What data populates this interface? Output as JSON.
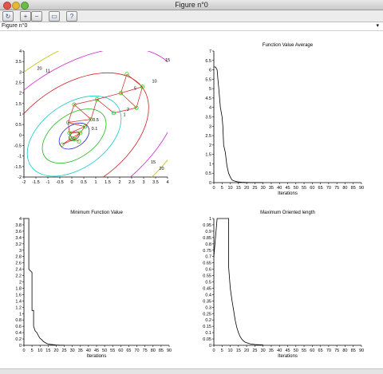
{
  "window": {
    "title": "Figure n°0"
  },
  "toolbar": {
    "buttons": [
      {
        "name": "rotate-icon",
        "glyph": "↻"
      },
      {
        "name": "zoom-in-icon",
        "glyph": "+"
      },
      {
        "name": "zoom-out-icon",
        "glyph": "−"
      },
      {
        "name": "datatip-icon",
        "glyph": "▭"
      },
      {
        "name": "help-icon",
        "glyph": "?"
      }
    ]
  },
  "figure_label": "Figure n°0",
  "menu_glyph": "▾",
  "chart_data": [
    {
      "type": "contour",
      "title": "",
      "xticks": [
        "-2",
        "-1.5",
        "-1",
        "-0.5",
        "0",
        "0.5",
        "1",
        "1.5",
        "2",
        "2.5",
        "3",
        "3.5",
        "4"
      ],
      "yticks": [
        "-2",
        "-1.5",
        "-1",
        "-0.5",
        "0",
        "0.5",
        "1",
        "1.5",
        "2",
        "2.5",
        "3",
        "3.5",
        "4"
      ],
      "xlim": [
        -2,
        4
      ],
      "ylim": [
        -2,
        4
      ],
      "contours": [
        {
          "level": "0.1",
          "color": "#444444",
          "rx": 0.25,
          "ry": 0.15
        },
        {
          "level": "0.5",
          "color": "#2a2ad0",
          "rx": 0.7,
          "ry": 0.45
        },
        {
          "level": "1",
          "color": "#1bb81b",
          "rx": 1.5,
          "ry": 0.9
        },
        {
          "level": "2",
          "color": "#14c9c9",
          "rx": 2.2,
          "ry": 1.35
        },
        {
          "level": "5",
          "color": "#d02020",
          "rx": 3.5,
          "ry": 2.1
        },
        {
          "level": "10",
          "color": "#d020d0",
          "rx": 5.0,
          "ry": 2.8
        },
        {
          "level": "15",
          "color": "#c0c000",
          "rx": 6.0,
          "ry": 3.4
        }
      ],
      "contour_labels": [
        "0.1",
        "0.5",
        "1",
        "2",
        "5",
        "10",
        "11",
        "15",
        "15",
        "20",
        "20"
      ],
      "simplex_points": [
        [
          2.3,
          2.9
        ],
        [
          2.95,
          2.3
        ],
        [
          2.05,
          2.0
        ],
        [
          2.7,
          1.3
        ],
        [
          1.05,
          1.7
        ],
        [
          1.75,
          1.05
        ],
        [
          0.1,
          1.45
        ],
        [
          0.8,
          0.75
        ],
        [
          -0.15,
          0.6
        ],
        [
          0.55,
          0.4
        ],
        [
          -0.1,
          0.1
        ],
        [
          0.35,
          0.1
        ],
        [
          0.0,
          -0.15
        ],
        [
          -0.4,
          -0.45
        ],
        [
          0.1,
          -0.2
        ],
        [
          0.3,
          -0.3
        ]
      ],
      "simplex_path": [
        [
          2.3,
          2.9
        ],
        [
          2.95,
          2.3
        ],
        [
          2.05,
          2.0
        ],
        [
          2.3,
          2.9
        ],
        [
          2.05,
          2.0
        ],
        [
          2.7,
          1.3
        ],
        [
          2.95,
          2.3
        ],
        [
          2.05,
          2.0
        ],
        [
          1.05,
          1.7
        ],
        [
          1.75,
          1.05
        ],
        [
          2.7,
          1.3
        ],
        [
          1.75,
          1.05
        ],
        [
          1.05,
          1.7
        ],
        [
          0.1,
          1.45
        ],
        [
          0.8,
          0.75
        ],
        [
          1.05,
          1.7
        ],
        [
          0.8,
          0.75
        ],
        [
          -0.15,
          0.6
        ],
        [
          0.1,
          1.45
        ],
        [
          0.8,
          0.75
        ],
        [
          0.55,
          0.4
        ],
        [
          -0.15,
          0.6
        ],
        [
          -0.1,
          0.1
        ],
        [
          0.55,
          0.4
        ],
        [
          0.35,
          0.1
        ],
        [
          -0.1,
          0.1
        ],
        [
          0.0,
          -0.15
        ],
        [
          0.35,
          0.1
        ],
        [
          0.1,
          -0.2
        ],
        [
          -0.4,
          -0.45
        ],
        [
          0.0,
          -0.15
        ],
        [
          0.3,
          -0.3
        ],
        [
          0.1,
          -0.2
        ]
      ]
    },
    {
      "type": "line",
      "title": "Function Value Average",
      "xlabel": "Iterations",
      "xticks": [
        "0",
        "5",
        "10",
        "15",
        "20",
        "25",
        "30",
        "35",
        "40",
        "45",
        "50",
        "55",
        "60",
        "65",
        "70",
        "75",
        "80",
        "85",
        "90"
      ],
      "yticks": [
        "0",
        "0.5",
        "1",
        "1.5",
        "2",
        "2.5",
        "3",
        "3.5",
        "4",
        "4.5",
        "5",
        "5.5",
        "6",
        "6.5",
        "7"
      ],
      "xlim": [
        0,
        90
      ],
      "ylim": [
        0,
        7
      ],
      "x": [
        0,
        1,
        2,
        2.5,
        3,
        4,
        5,
        5.5,
        6,
        7,
        8,
        9,
        10,
        11,
        12,
        13,
        14,
        15,
        16,
        17,
        18,
        19,
        20,
        22,
        25,
        30
      ],
      "y": [
        6.15,
        6.15,
        6.0,
        5.5,
        5.0,
        4.0,
        3.5,
        3.0,
        2.0,
        1.6,
        0.9,
        0.5,
        0.3,
        0.15,
        0.1,
        0.07,
        0.05,
        0.04,
        0.03,
        0.02,
        0.015,
        0.01,
        0.008,
        0.005,
        0.003,
        0.002
      ]
    },
    {
      "type": "line",
      "title": "Minimum Function Value",
      "xlabel": "Iterations",
      "xticks": [
        "0",
        "5",
        "10",
        "15",
        "20",
        "25",
        "30",
        "35",
        "40",
        "45",
        "50",
        "55",
        "60",
        "65",
        "70",
        "75",
        "80",
        "85",
        "90"
      ],
      "yticks": [
        "0",
        "0.2",
        "0.4",
        "0.6",
        "0.8",
        "1",
        "1.2",
        "1.4",
        "1.6",
        "1.8",
        "2",
        "2.2",
        "2.4",
        "2.6",
        "2.8",
        "3",
        "3.2",
        "3.4",
        "3.6",
        "3.8",
        "4"
      ],
      "xlim": [
        0,
        90
      ],
      "ylim": [
        0,
        4
      ],
      "x": [
        0,
        3,
        3,
        5,
        5,
        6,
        6,
        7,
        8,
        9,
        10,
        11,
        12,
        13,
        14,
        15,
        16,
        18,
        20,
        22,
        25
      ],
      "y": [
        4.0,
        4.0,
        2.4,
        2.3,
        1.1,
        1.1,
        0.6,
        0.45,
        0.4,
        0.3,
        0.22,
        0.18,
        0.12,
        0.09,
        0.06,
        0.04,
        0.03,
        0.02,
        0.01,
        0.005,
        0.003
      ]
    },
    {
      "type": "line",
      "title": "Maximum Oriented length",
      "xlabel": "Iterations",
      "xticks": [
        "0",
        "5",
        "10",
        "15",
        "20",
        "25",
        "30",
        "35",
        "40",
        "45",
        "50",
        "55",
        "60",
        "65",
        "70",
        "75",
        "80",
        "85",
        "90"
      ],
      "yticks": [
        "0",
        "0.05",
        "0.1",
        "0.15",
        "0.2",
        "0.25",
        "0.3",
        "0.35",
        "0.4",
        "0.45",
        "0.5",
        "0.55",
        "0.6",
        "0.65",
        "0.7",
        "0.75",
        "0.8",
        "0.85",
        "0.9",
        "0.95",
        "1"
      ],
      "xlim": [
        0,
        90
      ],
      "ylim": [
        0,
        1
      ],
      "x": [
        0,
        2,
        4,
        7,
        9,
        9,
        10,
        11,
        12,
        13,
        14,
        15,
        16,
        17,
        18,
        19,
        20,
        22,
        25,
        30
      ],
      "y": [
        0.7,
        1.0,
        1.0,
        1.0,
        1.0,
        0.62,
        0.45,
        0.36,
        0.28,
        0.2,
        0.14,
        0.1,
        0.07,
        0.05,
        0.035,
        0.025,
        0.02,
        0.012,
        0.006,
        0.003
      ]
    }
  ]
}
